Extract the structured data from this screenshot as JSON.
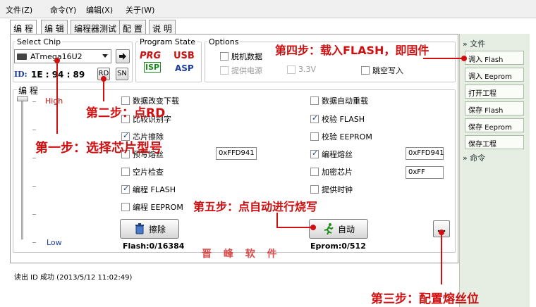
{
  "menu": [
    "文件(Z)",
    "命令(Y)",
    "编辑(X)",
    "关于(W)"
  ],
  "tabs": [
    "编 程",
    "编 辑",
    "编程器测试",
    "配 置",
    "说 明"
  ],
  "select_chip": {
    "title": "Select Chip",
    "chip": "ATmega16U2",
    "id_label": "ID:",
    "id_value": "1E : 94 : 89",
    "rd_label": "RD",
    "sn_label": "SN"
  },
  "program_state": {
    "title": "Program State",
    "logo1_top": "PRG",
    "logo1_bottom": "ISP",
    "logo2_top": "USB",
    "logo2_bottom": "ASP"
  },
  "options": {
    "title": "Options",
    "offline": "脱机数据",
    "power": "提供电源",
    "v33": "3.3V",
    "skip": "跳空写入"
  },
  "program_section": {
    "title": "编 程",
    "slider_high": "High",
    "slider_low": "Low",
    "left_checks": [
      {
        "label": "数据改变下载",
        "checked": false
      },
      {
        "label": "比较识别字",
        "checked": false
      },
      {
        "label": "芯片擦除",
        "checked": true
      },
      {
        "label": "预写熔丝",
        "checked": false
      },
      {
        "label": "空片检查",
        "checked": false
      },
      {
        "label": "编程 FLASH",
        "checked": true
      },
      {
        "label": "编程 EEPROM",
        "checked": false
      }
    ],
    "right_checks": [
      {
        "label": "数据自动重载",
        "checked": false
      },
      {
        "label": "校验 FLASH",
        "checked": true
      },
      {
        "label": "校验 EEPROM",
        "checked": false
      },
      {
        "label": "编程熔丝",
        "checked": true
      },
      {
        "label": "加密芯片",
        "checked": false
      },
      {
        "label": "提供时钟",
        "checked": false
      }
    ],
    "prewrite_fuse_value": "0xFFD941",
    "fuse_value": "0xFFD941",
    "lock_value": "0xFF",
    "erase_button": "擦除",
    "auto_button": "自动",
    "more_button": "...",
    "flash_status": "Flash:0/16384",
    "eeprom_status": "Eprom:0/512"
  },
  "log": {
    "line": "读出 ID 成功 (2013/5/12 11:02:49)"
  },
  "sidebar": {
    "file_header": "文件",
    "buttons": [
      "调入 Flash",
      "调入 Eeprom",
      "打开工程",
      "保存 Flash",
      "保存 Eeprom",
      "保存工程"
    ],
    "command_header": "命令"
  },
  "annotations": {
    "step1": "第一步：选择芯片型号",
    "step2": "第二步：点RD",
    "step3": "第三步：配置熔丝位",
    "step4": "第四步：载入FLASH，即固件",
    "step5": "第五步：点自动进行烧写",
    "watermark": "晋 峰 软 件"
  },
  "colors": {
    "annotation": "#d01010",
    "sidebar_bg": "#e6eee3"
  }
}
